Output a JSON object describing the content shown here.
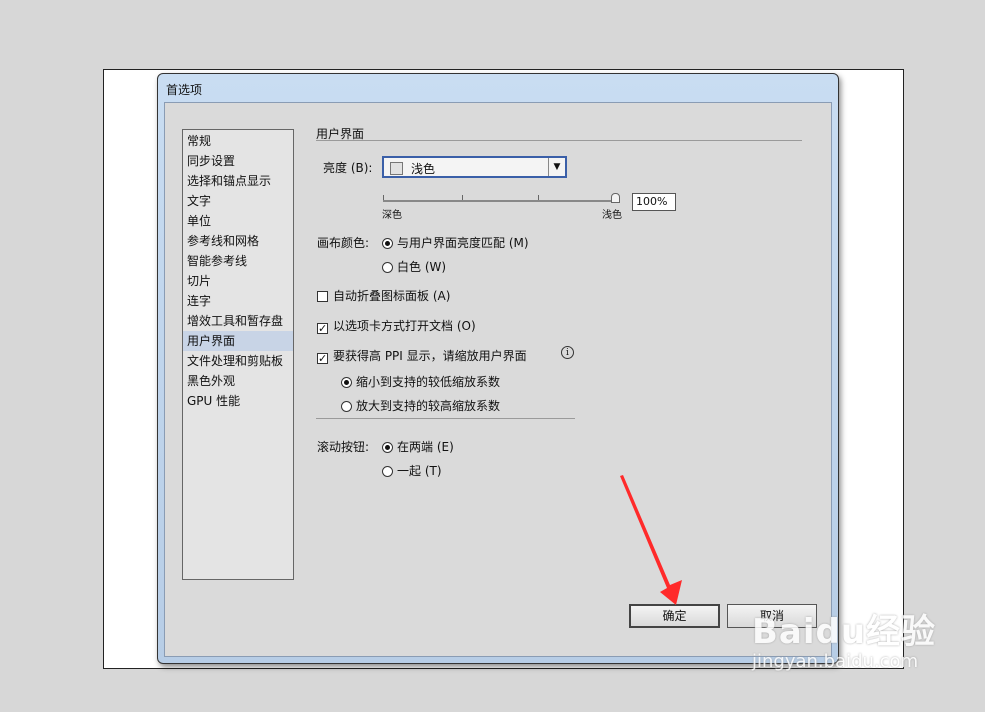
{
  "dialog": {
    "title": "首选项"
  },
  "sidebar": {
    "items": [
      {
        "label": "常规"
      },
      {
        "label": "同步设置"
      },
      {
        "label": "选择和锚点显示"
      },
      {
        "label": "文字"
      },
      {
        "label": "单位"
      },
      {
        "label": "参考线和网格"
      },
      {
        "label": "智能参考线"
      },
      {
        "label": "切片"
      },
      {
        "label": "连字"
      },
      {
        "label": "增效工具和暂存盘"
      },
      {
        "label": "用户界面",
        "selected": true
      },
      {
        "label": "文件处理和剪贴板"
      },
      {
        "label": "黑色外观"
      },
      {
        "label": "GPU 性能"
      }
    ]
  },
  "panel": {
    "section_title": "用户界面",
    "brightness": {
      "label": "亮度 (B):",
      "selected": "浅色",
      "slider_min_label": "深色",
      "slider_max_label": "浅色",
      "value_text": "100%",
      "value": 1.0
    },
    "canvas_color": {
      "label": "画布颜色:",
      "options": [
        {
          "label": "与用户界面亮度匹配 (M)",
          "checked": true
        },
        {
          "label": "白色 (W)",
          "checked": false
        }
      ]
    },
    "auto_collapse": {
      "label": "自动折叠图标面板 (A)",
      "checked": false
    },
    "open_tabs": {
      "label": "以选项卡方式打开文档 (O)",
      "checked": true
    },
    "high_ppi": {
      "label": "要获得高 PPI 显示，请缩放用户界面",
      "checked": true,
      "options": [
        {
          "label": "缩小到支持的较低缩放系数",
          "checked": true
        },
        {
          "label": "放大到支持的较高缩放系数",
          "checked": false
        }
      ]
    },
    "scroll_buttons": {
      "label": "滚动按钮:",
      "options": [
        {
          "label": "在两端 (E)",
          "checked": true
        },
        {
          "label": "一起 (T)",
          "checked": false
        }
      ]
    }
  },
  "buttons": {
    "ok": "确定",
    "cancel": "取消"
  },
  "annotation": {
    "color": "#ff2a2a"
  },
  "watermark": {
    "brand": "Baidu经验",
    "url": "jingyan.baidu.com"
  }
}
